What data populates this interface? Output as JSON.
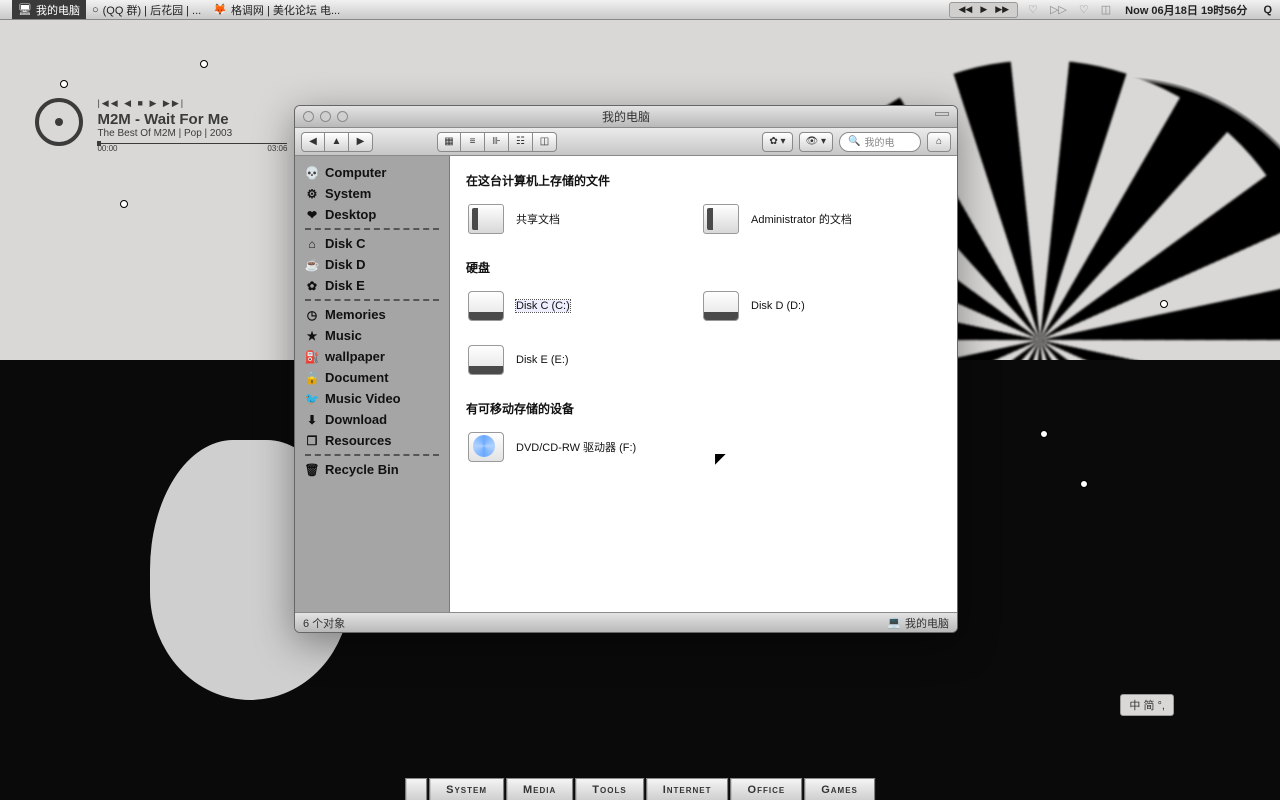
{
  "menubar": {
    "items": [
      {
        "label": "格调网 | 美化论坛 电...",
        "icon": "firefox"
      },
      {
        "label": "(QQ 群) | 后花园 | ...",
        "icon": "chat"
      },
      {
        "label": "我的电脑",
        "icon": "monitor",
        "active": true
      }
    ],
    "clock": "Now 06月18日 19时56分"
  },
  "music": {
    "controls": "|◀◀  ◀  ■  ▶  ▶▶|",
    "title": "M2M - Wait For Me",
    "subtitle": "The Best Of M2M  |  Pop  |  2003",
    "time_start": "00:00",
    "time_end": "03:06"
  },
  "window": {
    "title": "我的电脑",
    "search_placeholder": "我的电",
    "sidebar": [
      {
        "icon": "💀",
        "label": "Computer"
      },
      {
        "icon": "⚙",
        "label": "System"
      },
      {
        "icon": "❤",
        "label": "Desktop"
      },
      {
        "sep": true
      },
      {
        "icon": "⌂",
        "label": "Disk C"
      },
      {
        "icon": "☕",
        "label": "Disk D"
      },
      {
        "icon": "✿",
        "label": "Disk E"
      },
      {
        "sep": true
      },
      {
        "icon": "◷",
        "label": "Memories"
      },
      {
        "icon": "★",
        "label": "Music"
      },
      {
        "icon": "⛽",
        "label": "wallpaper"
      },
      {
        "icon": "🔒",
        "label": "Document"
      },
      {
        "icon": "🐦",
        "label": "Music Video"
      },
      {
        "icon": "⬇",
        "label": "Download"
      },
      {
        "icon": "❒",
        "label": "Resources"
      },
      {
        "sep": true
      },
      {
        "icon": "🗑",
        "label": "Recycle Bin"
      }
    ],
    "sections": [
      {
        "header": "在这台计算机上存储的文件",
        "items": [
          {
            "type": "folder",
            "label": "共享文档"
          },
          {
            "type": "folder",
            "label": "Administrator 的文档"
          }
        ]
      },
      {
        "header": "硬盘",
        "items": [
          {
            "type": "drive",
            "label": "Disk C (C:)",
            "selected": true
          },
          {
            "type": "drive",
            "label": "Disk D (D:)"
          },
          {
            "type": "drive",
            "label": "Disk E (E:)"
          }
        ]
      },
      {
        "header": "有可移动存储的设备",
        "items": [
          {
            "type": "optical",
            "label": "DVD/CD-RW 驱动器 (F:)"
          }
        ]
      }
    ],
    "status_left": "6 个对象",
    "status_right": "我的电脑"
  },
  "lang": "中 简 °,",
  "dock": [
    "",
    "System",
    "Media",
    "Tools",
    "Internet",
    "Office",
    "Games"
  ]
}
